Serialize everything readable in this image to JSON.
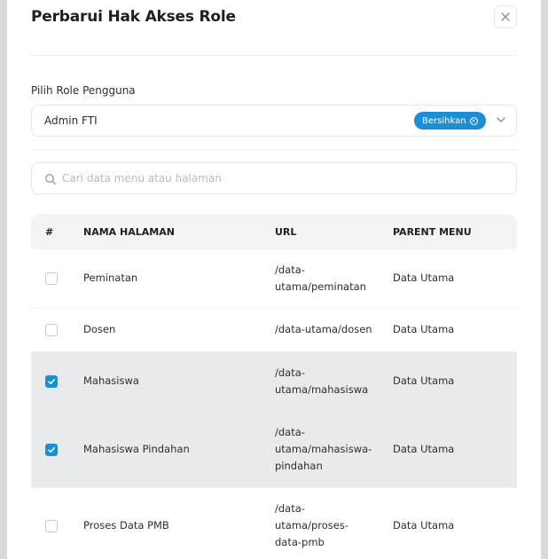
{
  "modal": {
    "title": "Perbarui Hak Akses Role",
    "close_icon": "close-icon"
  },
  "role": {
    "label": "Pilih Role Pengguna",
    "selected": "Admin FTI",
    "clear_label": "Bersihkan"
  },
  "search": {
    "placeholder": "Cari data menu atau halaman",
    "value": ""
  },
  "table": {
    "headers": {
      "index": "#",
      "name": "NAMA HALAMAN",
      "url": "URL",
      "parent": "PARENT MENU"
    },
    "rows": [
      {
        "name": "Peminatan",
        "url_lines": [
          "/data-",
          "utama/peminatan"
        ],
        "parent": "Data Utama",
        "checked": false
      },
      {
        "name": "Dosen",
        "url_lines": [
          "/data-utama/dosen"
        ],
        "parent": "Data Utama",
        "checked": false
      },
      {
        "name": "Mahasiswa",
        "url_lines": [
          "/data-",
          "utama/mahasiswa"
        ],
        "parent": "Data Utama",
        "checked": true
      },
      {
        "name": "Mahasiswa Pindahan",
        "url_lines": [
          "/data-",
          "utama/mahasiswa-",
          "pindahan"
        ],
        "parent": "Data Utama",
        "checked": true
      },
      {
        "name": "Proses Data PMB",
        "url_lines": [
          "/data-",
          "utama/proses-",
          "data-pmb"
        ],
        "parent": "Data Utama",
        "checked": false
      }
    ]
  },
  "colors": {
    "accent": "#1b8fd6",
    "selected_row": "#e9eaec"
  }
}
